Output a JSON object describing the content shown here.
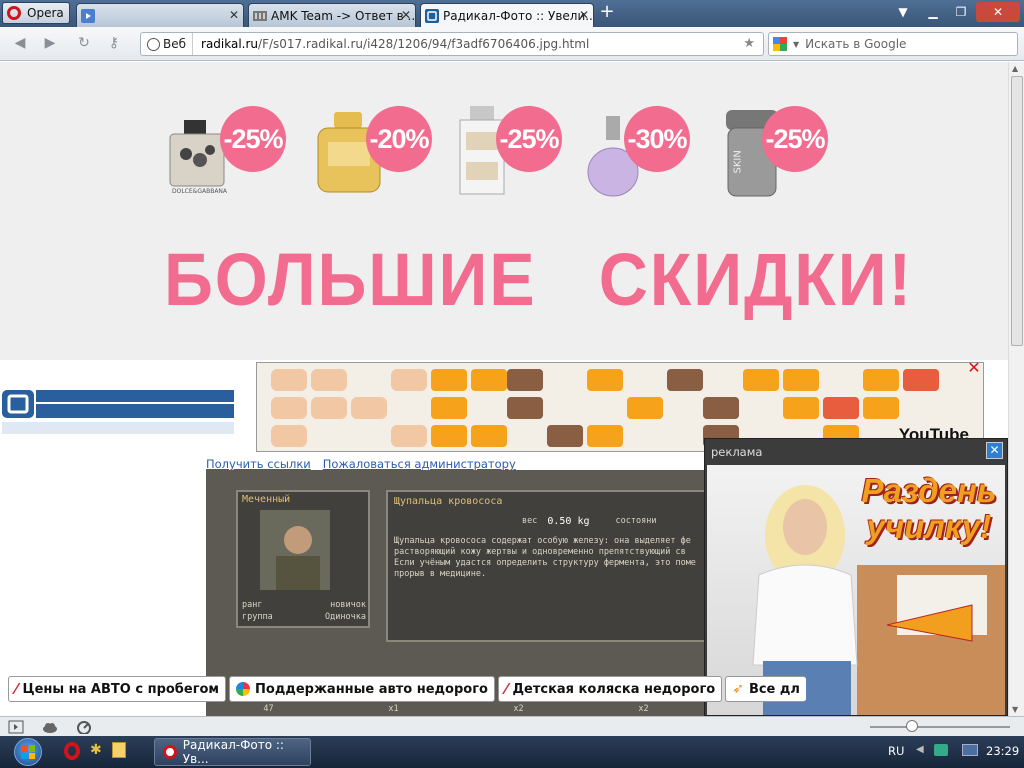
{
  "browser": {
    "menu_label": "Opera",
    "tabs": [
      {
        "title": ""
      },
      {
        "title": "AMK Team -> Ответ в ..."
      },
      {
        "title": "Радикал-Фото :: Увели..."
      }
    ],
    "address": {
      "scope_label": "Веб",
      "url_domain": "radikal.ru",
      "url_path": "/F/s017.radikal.ru/i428/1206/94/f3adf6706406.jpg.html"
    },
    "search_placeholder": "Искать в Google"
  },
  "banner": {
    "discounts": [
      "-25%",
      "-20%",
      "-25%",
      "-30%",
      "-25%"
    ],
    "headline": "БОЛЬШИЕ   СКИДКИ!",
    "brand_label": "DOLCE&GABBANA",
    "skin_label": "SKIN"
  },
  "youtube_ad": {
    "brand": "YouTube"
  },
  "page_links": [
    "Получить ссылки",
    "Пожаловаться администратору"
  ],
  "game": {
    "character_name": "Меченный",
    "rank_label": "ранг",
    "rank_value": "новичок",
    "group_label": "группа",
    "group_value": "Одиночка",
    "item_title": "Щупальца кровососа",
    "weight_label": "вес",
    "weight_value": "0.50 kg",
    "condition_label": "состояни",
    "description": "Щупальца кровососа содержат особую железу: она выделяет фе растворяющий кожу жертвы и одновременно препятствующий св Если учёным удастся определить структуру фермента, это поме прорыв в медицине.",
    "counters": [
      "47",
      "x1",
      "x2",
      "x2"
    ]
  },
  "popup_ad": {
    "title": "реклама",
    "headline": "Раздень училку!"
  },
  "ad_bar": [
    {
      "label": "Цены на АВТО с пробегом"
    },
    {
      "label": "Поддержанные авто недорого"
    },
    {
      "label": "Детская коляска недорого"
    },
    {
      "label": "Все дл"
    }
  ],
  "taskbar": {
    "task_title": "Радикал-Фото :: Ув...",
    "language": "RU",
    "clock": "23:29"
  },
  "colors": {
    "accent_pink": "#f26c8f",
    "link_blue": "#2a5db0"
  }
}
